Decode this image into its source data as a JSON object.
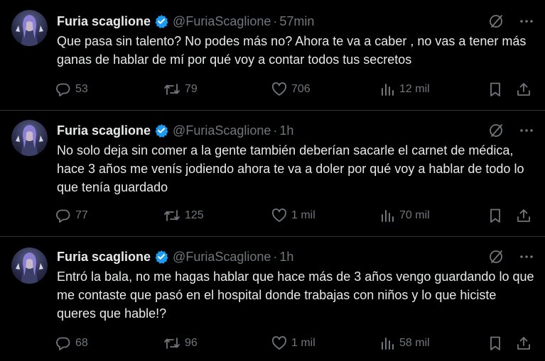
{
  "tweets": [
    {
      "author_name": "Furia scaglione",
      "handle": "@FuriaScaglione",
      "separator": "·",
      "time": "57min",
      "text": "Que pasa sin talento? No podes más no? Ahora te va a caber , no vas a tener más ganas de hablar de mí por qué voy a contar todos tus secretos",
      "replies": "53",
      "retweets": "79",
      "likes": "706",
      "views": "12 mil"
    },
    {
      "author_name": "Furia scaglione",
      "handle": "@FuriaScaglione",
      "separator": "·",
      "time": "1h",
      "text": "No solo deja sin comer a la gente también deberían sacarle el carnet de médica, hace 3 años me venís jodiendo ahora te va a doler por qué voy a hablar de todo lo que tenía guardado",
      "replies": "77",
      "retweets": "125",
      "likes": "1 mil",
      "views": "70 mil"
    },
    {
      "author_name": "Furia scaglione",
      "handle": "@FuriaScaglione",
      "separator": "·",
      "time": "1h",
      "text": "Entró la bala, no me hagas hablar que hace más de 3 años vengo guardando lo que me contaste que pasó en el hospital donde trabajas con niños y lo que hiciste queres que hable!?",
      "replies": "68",
      "retweets": "96",
      "likes": "1 mil",
      "views": "58 mil"
    }
  ],
  "icons": {
    "verified": "verified-badge-icon",
    "grok": "grok-icon",
    "more": "more-icon",
    "reply": "reply-icon",
    "retweet": "retweet-icon",
    "like": "like-icon",
    "views": "views-icon",
    "bookmark": "bookmark-icon",
    "share": "share-icon"
  },
  "colors": {
    "background": "#000000",
    "text": "#e7e9ea",
    "muted": "#71767b",
    "verified": "#1d9bf0",
    "divider": "#2f3336"
  }
}
